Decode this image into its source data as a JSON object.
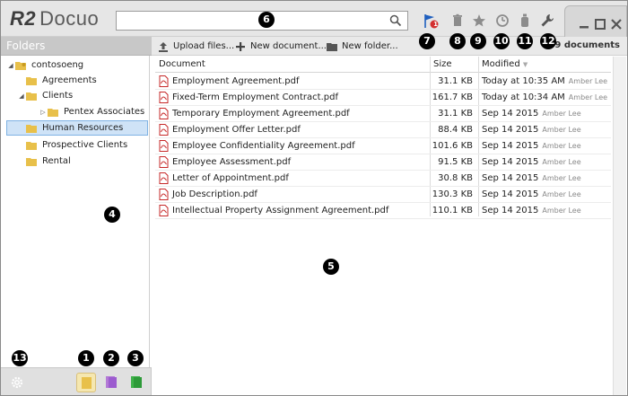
{
  "app": {
    "logo_mark": "R2",
    "logo_text": "Docuo"
  },
  "search": {
    "value": "",
    "placeholder": ""
  },
  "callouts": {
    "c1": "1",
    "c2": "2",
    "c3": "3",
    "c4": "4",
    "c5": "5",
    "c6": "6",
    "c7": "7",
    "c8": "8",
    "c9": "9",
    "c10": "10",
    "c11": "11",
    "c12": "12",
    "c13": "13"
  },
  "notification_badge": "1",
  "toolbar": {
    "upload_label": "Upload files...",
    "new_document_label": "New document...",
    "new_folder_label": "New folder...",
    "doc_count": "9 documents"
  },
  "folders": {
    "header": "Folders",
    "items": [
      {
        "label": "contosoeng",
        "level": 0,
        "expanded": true
      },
      {
        "label": "Agreements",
        "level": 1
      },
      {
        "label": "Clients",
        "level": 1,
        "expanded": true
      },
      {
        "label": "Pentex Associates",
        "level": 2,
        "collapsed": true
      },
      {
        "label": "Human Resources",
        "level": 1,
        "selected": true
      },
      {
        "label": "Prospective Clients",
        "level": 1
      },
      {
        "label": "Rental",
        "level": 1
      }
    ]
  },
  "table": {
    "headers": {
      "document": "Document",
      "size": "Size",
      "modified": "Modified"
    },
    "rows": [
      {
        "name": "Employment Agreement.pdf",
        "size": "31.1 KB",
        "modified": "Today at 10:35 AM",
        "by": "Amber Lee"
      },
      {
        "name": "Fixed-Term Employment Contract.pdf",
        "size": "161.7 KB",
        "modified": "Today at 10:34 AM",
        "by": "Amber Lee"
      },
      {
        "name": "Temporary Employment Agreement.pdf",
        "size": "31.1 KB",
        "modified": "Sep 14 2015",
        "by": "Amber Lee"
      },
      {
        "name": "Employment Offer Letter.pdf",
        "size": "88.4 KB",
        "modified": "Sep 14 2015",
        "by": "Amber Lee"
      },
      {
        "name": "Employee Confidentiality Agreement.pdf",
        "size": "101.6 KB",
        "modified": "Sep 14 2015",
        "by": "Amber Lee"
      },
      {
        "name": "Employee Assessment.pdf",
        "size": "91.5 KB",
        "modified": "Sep 14 2015",
        "by": "Amber Lee"
      },
      {
        "name": "Letter of Appointment.pdf",
        "size": "30.8 KB",
        "modified": "Sep 14 2015",
        "by": "Amber Lee"
      },
      {
        "name": "Job Description.pdf",
        "size": "130.3 KB",
        "modified": "Sep 14 2015",
        "by": "Amber Lee"
      },
      {
        "name": "Intellectual Property Assignment Agreement.pdf",
        "size": "110.1 KB",
        "modified": "Sep 14 2015",
        "by": "Amber Lee"
      }
    ]
  },
  "colors": {
    "accent_blue": "#1f5fbf",
    "folder_yellow": "#e8c04a",
    "pdf_red": "#c62828",
    "selected_bg": "#cfe3f7"
  },
  "icons": [
    "search-icon",
    "flag-icon",
    "trash-icon",
    "star-icon",
    "history-icon",
    "bottle-icon",
    "wrench-icon",
    "gear-icon",
    "folder-icon",
    "pdf-icon"
  ]
}
